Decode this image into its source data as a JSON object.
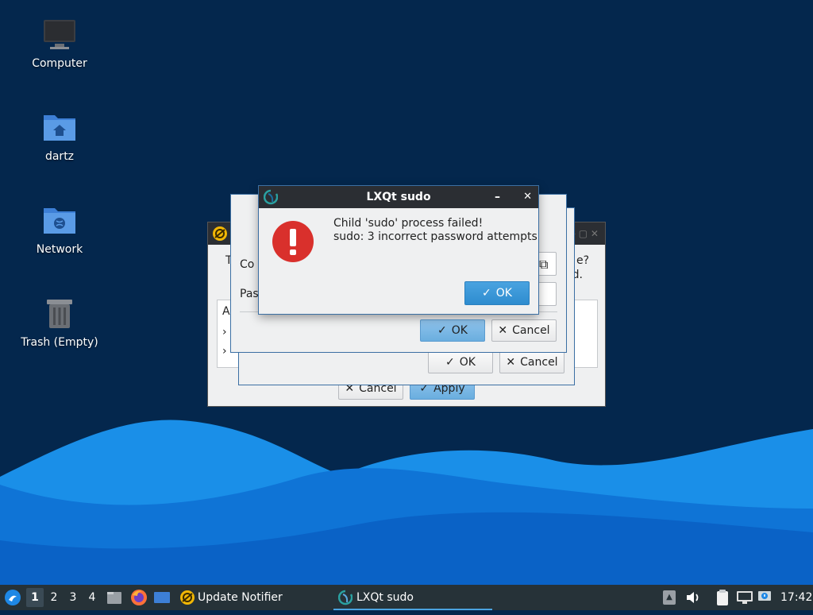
{
  "desktop": {
    "icons": [
      {
        "label": "Computer"
      },
      {
        "label": "dartz"
      },
      {
        "label": "Network"
      },
      {
        "label": "Trash (Empty)"
      }
    ]
  },
  "back_window": {
    "partial_text_left": "T",
    "partial_text_right_1": "e?",
    "partial_text_right_2": "d.",
    "list_header_partial": "A",
    "cancel_label": "Cancel",
    "apply_label": "Apply"
  },
  "middle_window": {
    "ok_label": "OK",
    "cancel_label": "Cancel"
  },
  "password_dialog": {
    "row1_partial": "Co",
    "row2_partial": "Pas",
    "ok_label": "OK",
    "cancel_label": "Cancel"
  },
  "error_dialog": {
    "title": "LXQt sudo",
    "message_line1": "Child 'sudo' process failed!",
    "message_line2": "sudo: 3 incorrect password attempts",
    "ok_label": "OK",
    "minimize_glyph": "–",
    "close_glyph": "✕"
  },
  "taskbar": {
    "workspaces": [
      "1",
      "2",
      "3",
      "4"
    ],
    "active_workspace": "1",
    "tasks": [
      {
        "label": "Update Notifier"
      },
      {
        "label": "LXQt sudo"
      }
    ],
    "clock": "17:42"
  },
  "colors": {
    "desktop_bg": "#04274d",
    "wave_light": "#1a8fe8",
    "wave_dark": "#0a62c6",
    "taskbar_bg": "#263238",
    "titlebar_bg": "#2b2e33",
    "accent": "#4aa3e0",
    "error_red": "#d9302c"
  }
}
